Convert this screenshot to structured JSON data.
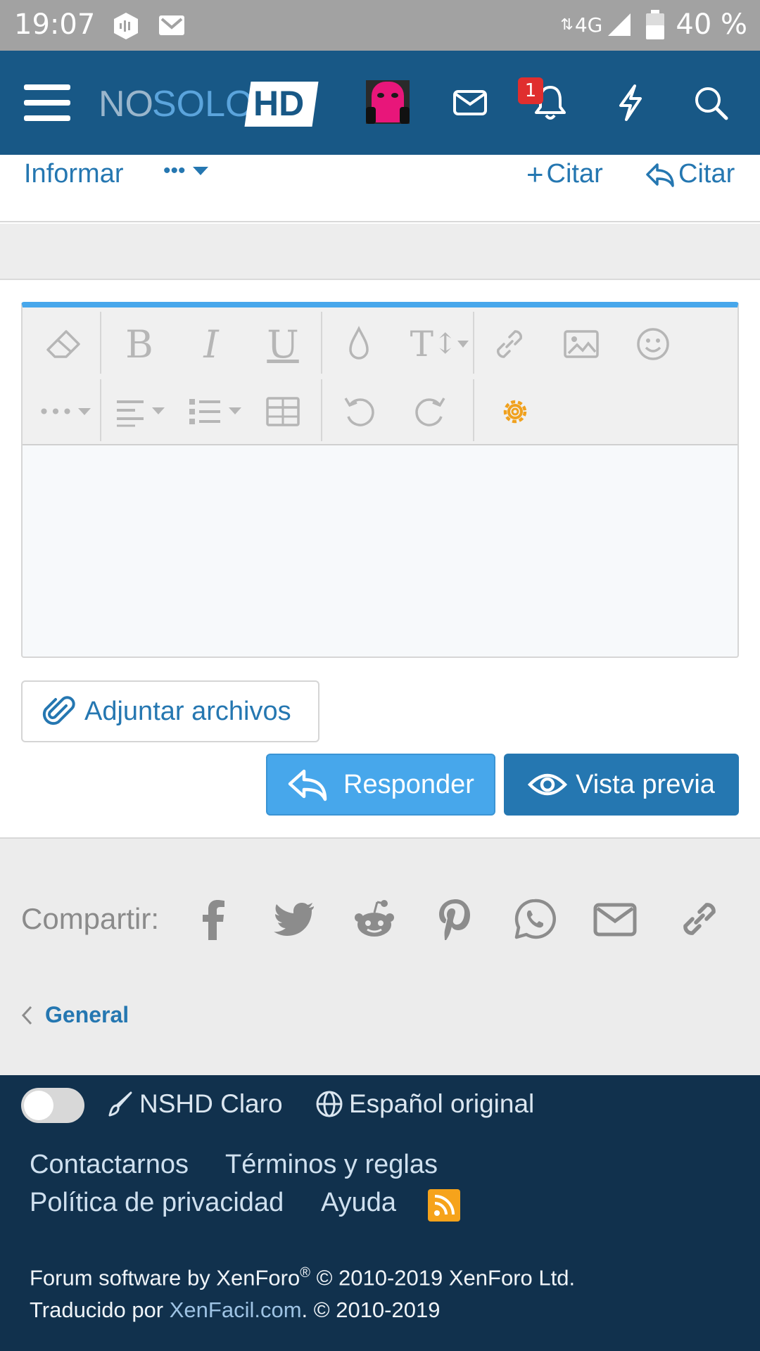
{
  "status": {
    "time": "19:07",
    "network": "4G",
    "battery": "40 %"
  },
  "header": {
    "logo_no": "NO",
    "logo_solo": "SOLO",
    "logo_hd": "HD",
    "notification_count": "1",
    "colors": {
      "bar": "#185886",
      "badge": "#e02e2e"
    }
  },
  "post_actions": {
    "report": "Informar",
    "more": "•••",
    "multiquote": "Citar",
    "quote": "Citar"
  },
  "editor": {
    "toolbar_icons": [
      "eraser-icon",
      "bold-icon",
      "italic-icon",
      "underline-icon",
      "text-color-icon",
      "font-size-icon",
      "link-icon",
      "image-icon",
      "smiley-icon",
      "more-options-icon",
      "align-icon",
      "list-icon",
      "table-icon",
      "undo-icon",
      "redo-icon",
      "settings-gear-icon"
    ],
    "accent": "#47a7eb"
  },
  "buttons": {
    "attach": "Adjuntar archivos",
    "reply": "Responder",
    "preview": "Vista previa"
  },
  "share": {
    "label": "Compartir:",
    "networks": [
      "facebook-icon",
      "twitter-icon",
      "reddit-icon",
      "pinterest-icon",
      "whatsapp-icon",
      "email-icon",
      "link-icon"
    ]
  },
  "breadcrumb": {
    "label": "General"
  },
  "footer": {
    "style": "NSHD Claro",
    "language": "Español original",
    "links": {
      "contact": "Contactarnos",
      "terms": "Términos y reglas",
      "privacy": "Política de privacidad",
      "help": "Ayuda"
    },
    "copyright_1": "Forum software by XenForo",
    "copyright_reg": "®",
    "copyright_1b": " © 2010-2019 XenForo Ltd.",
    "copyright_2a": "Traducido por ",
    "copyright_2_link": "XenFacil.com",
    "copyright_2b": ". © 2010-2019",
    "colors": {
      "background": "#11314d",
      "rss": "#f6a31b"
    }
  }
}
